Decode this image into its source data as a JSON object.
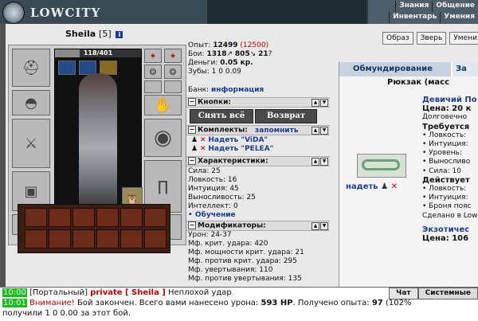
{
  "app": {
    "title": "LOWCITY"
  },
  "topnav": {
    "row1": [
      "Знания",
      "Общение"
    ],
    "row2": [
      "Инвентарь",
      "Умения"
    ]
  },
  "character": {
    "name": "Sheila",
    "level": "[5]",
    "hp_text": "118/401",
    "hp_fraction": 0.29
  },
  "stats": {
    "exp_label": "Опыт:",
    "exp_value": "12499",
    "exp_next": "(12500)",
    "battles_label": "Бои:",
    "battles_wins": "1318",
    "battles_losses": "805",
    "battles_draws": "21",
    "money_label": "Деньги:",
    "money_value": "0.05 кр.",
    "teeth_label": "Зубы:",
    "teeth_value": "1 0 0.09"
  },
  "bank": {
    "label": "Банк:",
    "link": "информация"
  },
  "buttons_section": {
    "title": "Кнопки:",
    "undress_all": "Снять всё",
    "return": "Возврат"
  },
  "sets": {
    "title": "Комплекты:",
    "remember": "запомнить",
    "items": [
      {
        "label": "Надеть \"ViDA\""
      },
      {
        "label": "Надеть \"PELEA\""
      }
    ]
  },
  "characteristics": {
    "title": "Характеристики:",
    "lines": [
      "Сила: 25",
      "Ловкость: 16",
      "Интуиция: 45",
      "Выносливость: 25",
      "Интеллект: 0"
    ],
    "training": "• Обучение"
  },
  "modifiers": {
    "title": "Модификаторы:",
    "lines": [
      "Урон: 24-37",
      "Мф. крит. удара: 420",
      "Мф. мощности крит. удара: 21",
      "Мф. против крит. удара: 295",
      "Мф. увертывания: 110",
      "Мф. против увертывания: 135"
    ]
  },
  "right_tabs": [
    "Образ",
    "Зверь",
    "Умения"
  ],
  "right_panel": {
    "active_tab": "Обмундирование",
    "tab2": "За",
    "backpack_title": "Рюкзак (масс",
    "wear_link": "надеть",
    "item1": {
      "name": "Девичий По",
      "price": "Цена: 20 к",
      "durability": "Долговечно",
      "requires": "Требуется",
      "req_lines": [
        "• Ловкость:",
        "• Интуиция:",
        "• Уровень:",
        "• Выносливо",
        "• Сила: 10"
      ],
      "acts": "Действует",
      "act_lines": [
        "• Ловкость:",
        "• Интуиция:",
        "• Броня пояс"
      ],
      "made": "Сделано в Low"
    },
    "item2": {
      "name": "Экзотичес",
      "price": "Цена: 106"
    }
  },
  "chat": {
    "line1": {
      "time": "10:00",
      "channel": "[Портальный]",
      "private": "private [ Sheila ]",
      "text": "Неплохой удар"
    },
    "line2": {
      "time": "10:01",
      "warn": "Внимание!",
      "text": "Бой закончен. Всего вами нанесено урона:",
      "damage": "593 HP",
      "text2": ". Получено опыта:",
      "exp": "97",
      "text3": "(102%"
    },
    "line3": {
      "text": "получили 1 0 0.00 за этот бой."
    },
    "tabs": [
      "Чат",
      "Системные"
    ]
  }
}
